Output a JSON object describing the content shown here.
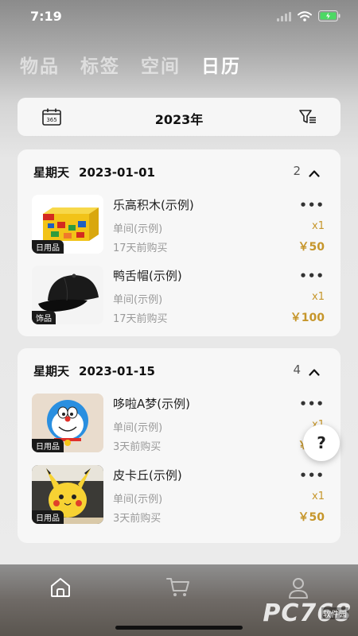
{
  "status_bar": {
    "time": "7:19"
  },
  "nav_tabs": [
    {
      "label": "物品",
      "active": false
    },
    {
      "label": "标签",
      "active": false
    },
    {
      "label": "空间",
      "active": false
    },
    {
      "label": "日历",
      "active": true
    }
  ],
  "year_bar": {
    "calendar_icon_text": "365",
    "year": "2023年"
  },
  "days": [
    {
      "weekday": "星期天",
      "date": "2023-01-01",
      "count": "2",
      "items": [
        {
          "name": "乐高积木(示例)",
          "location": "单间(示例)",
          "purchased": "17天前购买",
          "qty": "x1",
          "price": "￥50",
          "tag": "日用品",
          "more": "•••"
        },
        {
          "name": "鸭舌帽(示例)",
          "location": "单间(示例)",
          "purchased": "17天前购买",
          "qty": "x1",
          "price": "￥100",
          "tag": "饰品",
          "more": "•••"
        }
      ]
    },
    {
      "weekday": "星期天",
      "date": "2023-01-15",
      "count": "4",
      "items": [
        {
          "name": "哆啦A梦(示例)",
          "location": "单间(示例)",
          "purchased": "3天前购买",
          "qty": "x1",
          "price": "￥50",
          "tag": "日用品",
          "more": "•••"
        },
        {
          "name": "皮卡丘(示例)",
          "location": "单间(示例)",
          "purchased": "3天前购买",
          "qty": "x1",
          "price": "￥50",
          "tag": "日用品",
          "more": "•••"
        }
      ]
    }
  ],
  "help_button": {
    "label": "?"
  },
  "bottom_tabs": [
    {
      "icon": "home-icon"
    },
    {
      "icon": "cart-icon"
    },
    {
      "icon": "user-icon"
    }
  ],
  "watermark": {
    "text": "PC768",
    "sub": "软件园"
  },
  "colors": {
    "accent": "#c6962b"
  }
}
